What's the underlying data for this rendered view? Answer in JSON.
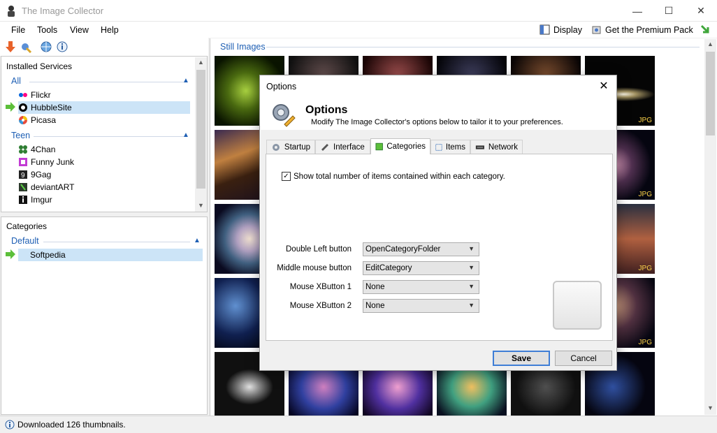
{
  "window": {
    "title": "The Image Collector"
  },
  "menu": {
    "file": "File",
    "tools": "Tools",
    "view": "View",
    "help": "Help",
    "display": "Display",
    "premium": "Get the Premium Pack"
  },
  "services": {
    "title": "Installed Services",
    "groups": [
      {
        "name": "All",
        "items": [
          "Flickr",
          "HubbleSite",
          "Picasa"
        ]
      },
      {
        "name": "Teen",
        "items": [
          "4Chan",
          "Funny Junk",
          "9Gag",
          "deviantART",
          "Imgur"
        ]
      }
    ]
  },
  "categories": {
    "title": "Categories",
    "group": "Default",
    "item": "Softpedia"
  },
  "gallery": {
    "section": "Still Images",
    "badge": "JPG"
  },
  "status": {
    "text": "Downloaded 126 thumbnails."
  },
  "dialog": {
    "title": "Options",
    "heading": "Options",
    "subtitle": "Modify The Image Collector's options below to tailor it to your preferences.",
    "tabs": [
      "Startup",
      "Interface",
      "Categories",
      "Items",
      "Network"
    ],
    "active_tab": "Categories",
    "checkbox_label": "Show total number of items contained within each category.",
    "checkbox_checked": true,
    "fields": [
      {
        "label": "Double Left button",
        "value": "OpenCategoryFolder"
      },
      {
        "label": "Middle mouse button",
        "value": "EditCategory"
      },
      {
        "label": "Mouse XButton 1",
        "value": "None"
      },
      {
        "label": "Mouse XButton 2",
        "value": "None"
      }
    ],
    "save": "Save",
    "cancel": "Cancel"
  },
  "colors": {
    "accent": "#1e5fb4",
    "selection": "#cce4f7",
    "jpg_badge": "#ffd64a"
  }
}
